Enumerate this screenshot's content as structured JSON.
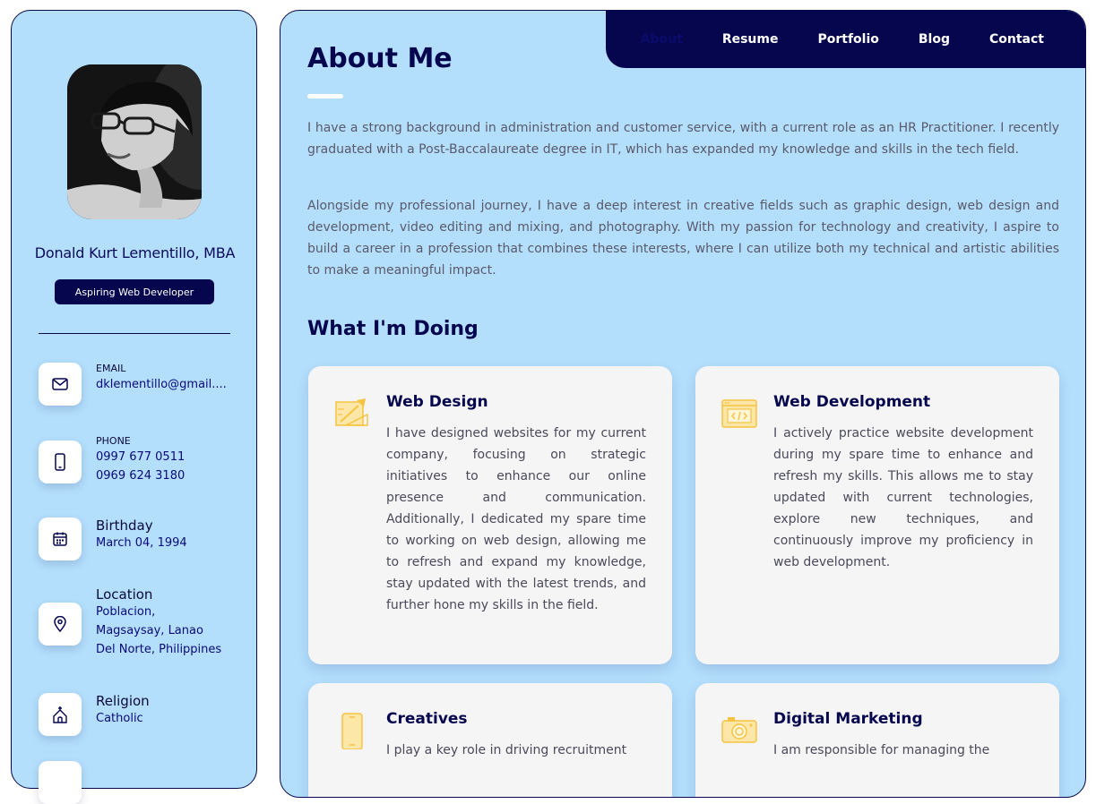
{
  "profile": {
    "name": "Donald Kurt Lementillo, MBA",
    "title": "Aspiring Web Developer"
  },
  "contacts": [
    {
      "label": "EMAIL",
      "icon": "mail-icon",
      "values": [
        "dklementillo@gmail...."
      ]
    },
    {
      "label": "PHONE",
      "icon": "phone-icon",
      "values": [
        "0997 677 0511",
        "0969 624 3180"
      ]
    },
    {
      "label": "Birthday",
      "icon": "calendar-icon",
      "values": [
        "March 04, 1994"
      ]
    },
    {
      "label": "Location",
      "icon": "location-pin-icon",
      "values": [
        "Poblacion,",
        "Magsaysay, Lanao",
        "Del Norte, Philippines"
      ]
    },
    {
      "label": "Religion",
      "icon": "church-icon",
      "values": [
        "Catholic"
      ]
    }
  ],
  "nav": {
    "items": [
      "About",
      "Resume",
      "Portfolio",
      "Blog",
      "Contact"
    ],
    "active": "About"
  },
  "about": {
    "heading": "About Me",
    "paragraphs": [
      "I have a strong background in administration and customer service, with a current role as an HR Practitioner. I recently graduated with a Post-Baccalaureate degree in IT, which has expanded my knowledge and skills in the tech field.",
      "Alongside my professional journey, I have a deep interest in creative fields such as graphic design, web design and development, video editing and mixing, and photography. With my passion for technology and creativity, I aspire to build a career in a profession that combines these interests, where I can utilize both my technical and artistic abilities to make a meaningful impact."
    ]
  },
  "services": {
    "heading": "What I'm Doing",
    "items": [
      {
        "title": "Web Design",
        "icon": "design-icon",
        "text": "I have designed websites for my current company, focusing on strategic initiatives to enhance our online presence and communication. Additionally, I dedicated my spare time to working on web design, allowing me to refresh and expand my knowledge, stay updated with the latest trends, and further hone my skills in the field."
      },
      {
        "title": "Web Development",
        "icon": "code-window-icon",
        "text": "I actively practice website development during my spare time to enhance and refresh my skills. This allows me to stay updated with current technologies, explore new techniques, and continuously improve my proficiency in web development."
      },
      {
        "title": "Creatives",
        "icon": "smartphone-icon",
        "text": "I play a key role in driving recruitment"
      },
      {
        "title": "Digital Marketing",
        "icon": "camera-icon",
        "text": "I am responsible for managing the"
      }
    ]
  },
  "colors": {
    "navy": "#06064f",
    "panel": "#b3defc",
    "card": "#f5f5f5",
    "icon_accent": "#f6c343"
  }
}
